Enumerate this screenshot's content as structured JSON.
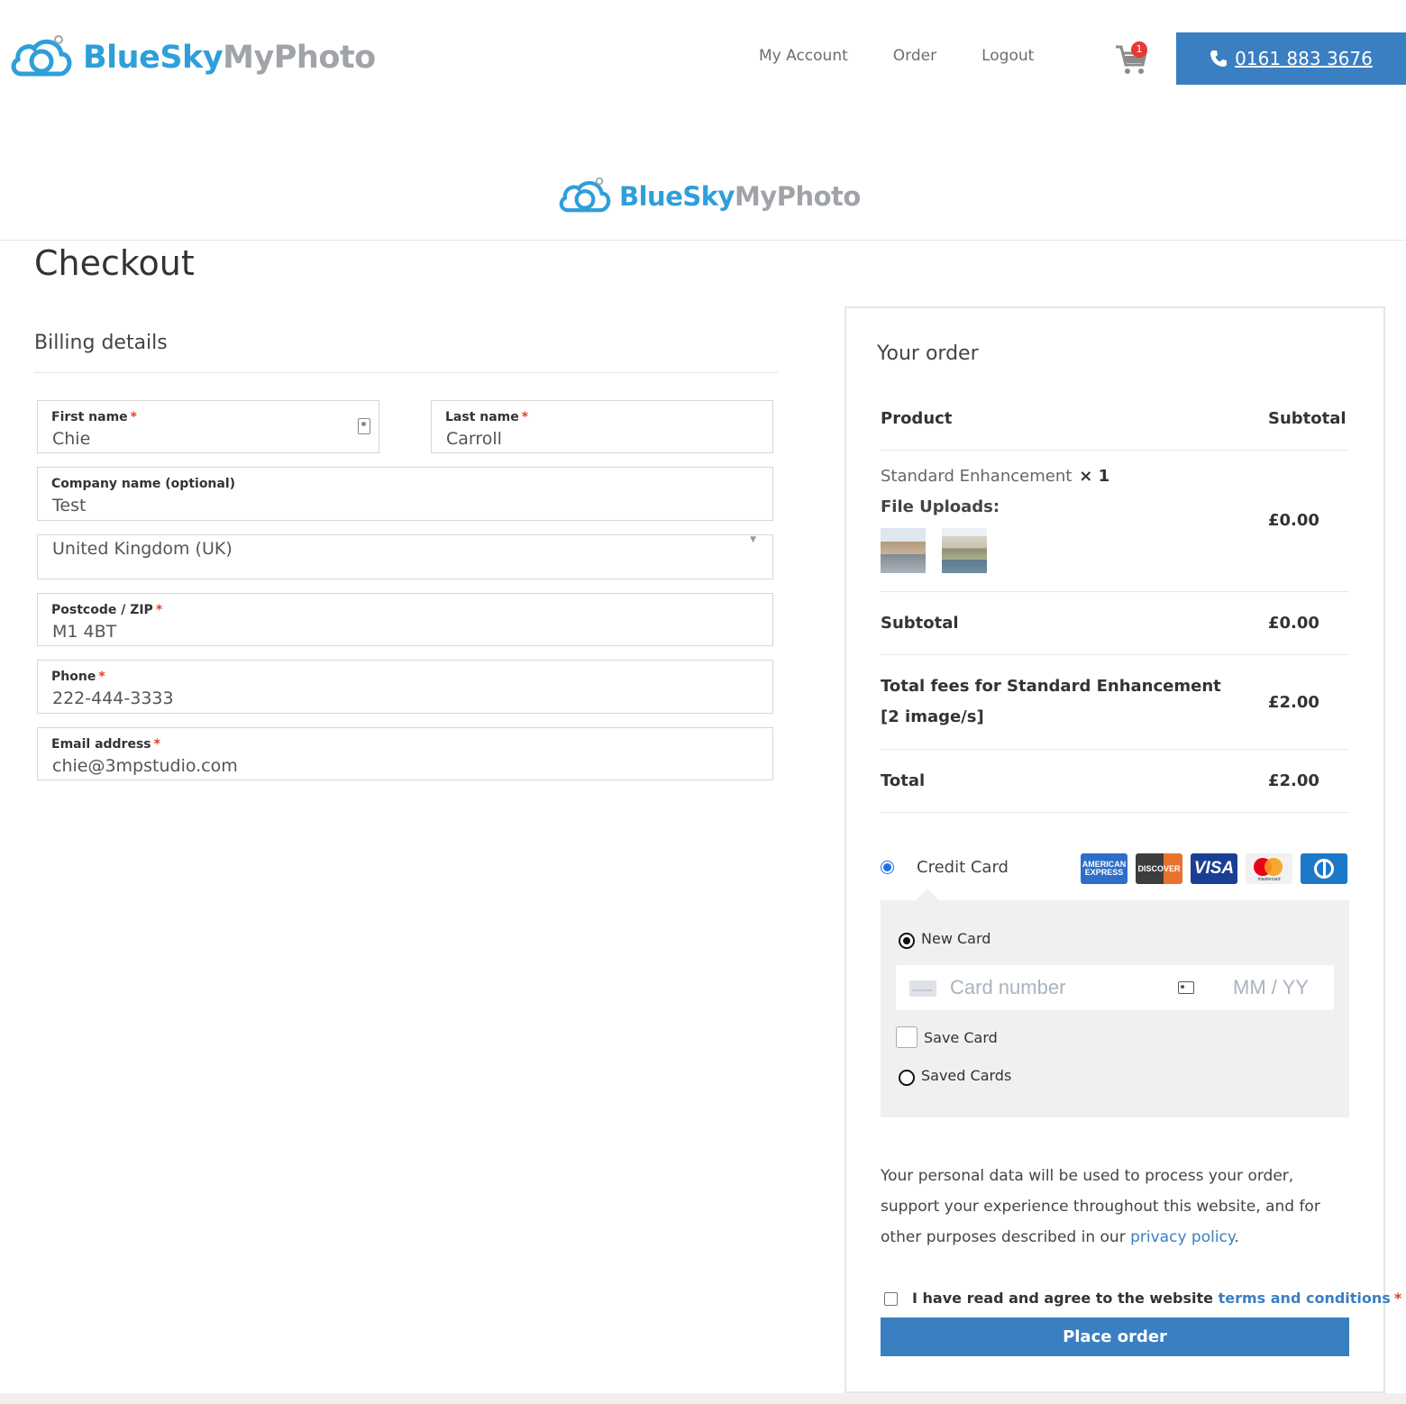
{
  "header": {
    "logo_part1": "BlueSky",
    "logo_part2": "MyPhoto",
    "nav": [
      "My Account",
      "Order",
      "Logout"
    ],
    "cart_count": "1",
    "phone": "0161 883 3676"
  },
  "center_logo": {
    "part1": "BlueSky",
    "part2": "MyPhoto"
  },
  "page_title": "Checkout",
  "billing": {
    "title": "Billing details",
    "first_name": {
      "label": "First name",
      "value": "Chie"
    },
    "last_name": {
      "label": "Last name",
      "value": "Carroll"
    },
    "company": {
      "label": "Company name (optional)",
      "value": "Test"
    },
    "country": {
      "value": "United Kingdom (UK)"
    },
    "postcode": {
      "label": "Postcode / ZIP",
      "value": "M1 4BT"
    },
    "phone": {
      "label": "Phone",
      "value": "222-444-3333"
    },
    "email": {
      "label": "Email address",
      "value": "chie@3mpstudio.com"
    },
    "required_mark": "*"
  },
  "order": {
    "title": "Your order",
    "col_product": "Product",
    "col_subtotal": "Subtotal",
    "item": {
      "name": "Standard Enhancement",
      "qty": "× 1",
      "file_uploads_label": "File Uploads:",
      "amount": "£0.00"
    },
    "subtotal": {
      "label": "Subtotal",
      "amount": "£0.00"
    },
    "fees": {
      "label": "Total fees for Standard Enhancement [2 image/s]",
      "amount": "£2.00"
    },
    "total": {
      "label": "Total",
      "amount": "£2.00"
    }
  },
  "payment": {
    "method_label": "Credit Card",
    "card_brands": [
      "AMERICAN EXPRESS",
      "DISCOVER",
      "VISA",
      "mastercard",
      "diners"
    ],
    "new_card": "New Card",
    "card_number_placeholder": "Card number",
    "expiry_placeholder": "MM / YY",
    "save_card": "Save Card",
    "saved_cards": "Saved Cards"
  },
  "privacy": {
    "text": "Your personal data will be used to process your order, support your experience throughout this website, and for other purposes described in our ",
    "link": "privacy policy",
    "end": "."
  },
  "terms": {
    "text": "I have read and agree to the website ",
    "link": "terms and conditions",
    "req": "*"
  },
  "place_order": "Place order",
  "colors": {
    "brand_blue": "#2e9fd9",
    "button_blue": "#3a7fc1",
    "required_red": "#e2401c"
  }
}
